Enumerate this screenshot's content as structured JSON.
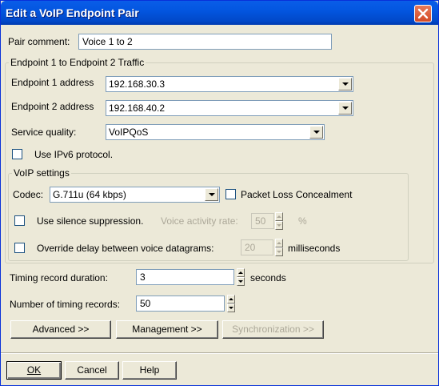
{
  "window": {
    "title": "Edit a VoIP Endpoint Pair"
  },
  "pair_comment": {
    "label": "Pair comment:",
    "value": "Voice 1 to 2"
  },
  "traffic_group": {
    "title": "Endpoint 1 to Endpoint 2 Traffic",
    "endpoint1": {
      "label": "Endpoint 1 address",
      "value": "192.168.30.3"
    },
    "endpoint2": {
      "label": "Endpoint 2 address",
      "value": "192.168.40.2"
    },
    "service_quality": {
      "label": "Service quality:",
      "value": "VoIPQoS"
    },
    "ipv6": {
      "label": "Use IPv6 protocol.",
      "checked": false
    }
  },
  "voip_group": {
    "title": "VoIP settings",
    "codec": {
      "label": "Codec:",
      "value": "G.711u (64 kbps)"
    },
    "packet_loss": {
      "label": "Packet Loss Concealment",
      "checked": false
    },
    "silence": {
      "label": "Use silence suppression.",
      "checked": false
    },
    "voice_activity": {
      "label": "Voice activity rate:",
      "value": "50",
      "unit": "%"
    },
    "override_delay": {
      "label": "Override delay between voice datagrams:",
      "checked": false,
      "value": "20",
      "unit": "milliseconds"
    }
  },
  "timing_duration": {
    "label": "Timing record duration:",
    "value": "3",
    "unit": "seconds"
  },
  "timing_records": {
    "label": "Number of timing records:",
    "value": "50"
  },
  "buttons": {
    "advanced": "Advanced >>",
    "management": "Management >>",
    "synchronization": "Synchronization >>",
    "ok": "OK",
    "cancel": "Cancel",
    "help": "Help"
  }
}
